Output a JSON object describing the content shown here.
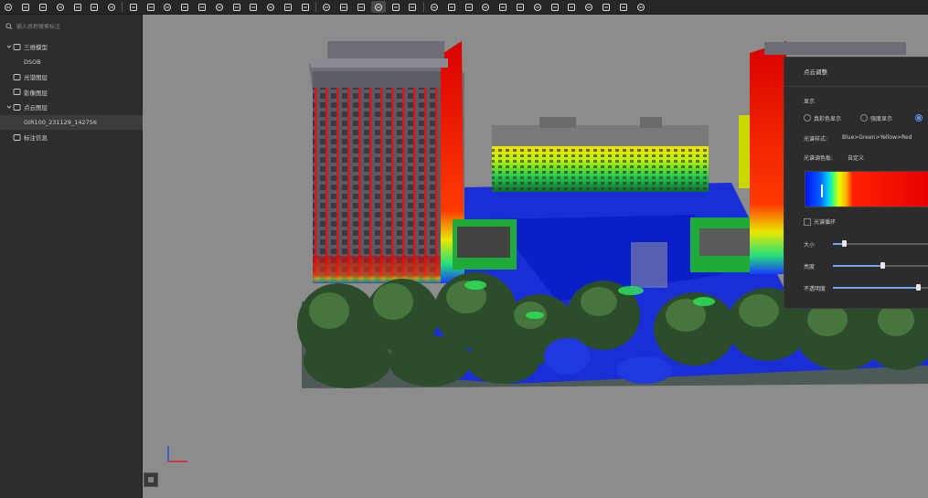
{
  "toolbar": {
    "buttons": [
      "new-file-icon",
      "open-folder-icon",
      "cloud-icon",
      "save-icon",
      "refresh-icon",
      "settings-icon",
      "close-circle-icon",
      "import-icon",
      "terrain-icon",
      "light-icon",
      "layer-split-icon",
      "copy-icon",
      "nodes-icon",
      "box-icon",
      "cube-icon",
      "cube-outline-icon",
      "wireframe-box-icon",
      "grid-box-icon",
      "orbit-icon",
      "zoom-extent-icon",
      "monitor-icon",
      "flag-active-icon",
      "move-icon",
      "rotate-view-icon",
      "pin-icon",
      "flag-icon",
      "ruler-icon",
      "volume-icon",
      "section-icon",
      "camera-icon",
      "mountain-icon",
      "crop-icon",
      "document-icon",
      "cursor-icon",
      "image-icon",
      "report-icon",
      "search-icon"
    ]
  },
  "sidebar": {
    "search_placeholder": "输入名称搜索标注",
    "tree": [
      {
        "label": "三维模型",
        "icon": "cube-icon",
        "expanded": true,
        "level": 0
      },
      {
        "label": "DSOB",
        "icon": "",
        "level": 1
      },
      {
        "label": "光谱图层",
        "icon": "layers-icon",
        "level": 0
      },
      {
        "label": "影像图层",
        "icon": "image-layer-icon",
        "level": 0
      },
      {
        "label": "点云图层",
        "icon": "point-cloud-icon",
        "expanded": true,
        "level": 0
      },
      {
        "label": "GIR100_231129_142756",
        "icon": "",
        "level": 1,
        "selected": true
      },
      {
        "label": "标注信息",
        "icon": "flag-icon",
        "level": 0
      }
    ]
  },
  "panel": {
    "title": "点云调整",
    "display_label": "显示",
    "radio_options": [
      "真彩色显示",
      "强度显示"
    ],
    "ramp_style_label": "光谱样式:",
    "ramp_style_value": "Blue>Green>Yellow>Red",
    "ramp_color_label": "光谱调色板:",
    "ramp_color_value": "自定义",
    "loop_label": "光谱循环",
    "size_label": "大小",
    "brightness_label": "亮度",
    "opacity_label": "不透明度",
    "size_value": 0.08,
    "brightness_value": 0.5,
    "opacity_value": 1.0
  },
  "colors": {
    "accent": "#5a9cf0",
    "viewport_bg": "#8c8c8c"
  }
}
